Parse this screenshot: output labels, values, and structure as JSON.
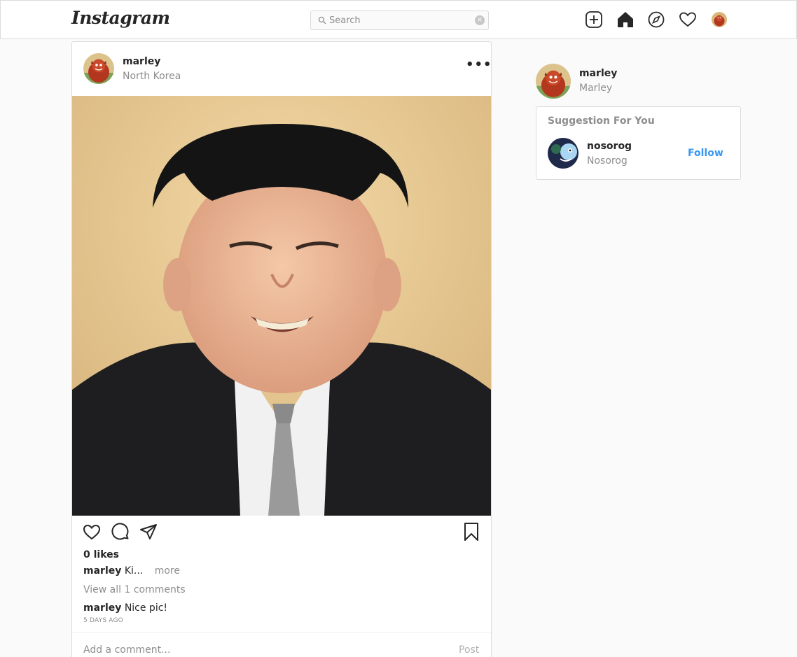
{
  "header": {
    "logo": "Instagram",
    "search_placeholder": "Search",
    "clear_symbol": "×",
    "icons": [
      "new-post-icon",
      "home-icon",
      "explore-icon",
      "activity-heart-icon",
      "profile-avatar"
    ]
  },
  "post": {
    "username": "marley",
    "location": "North Korea",
    "more_symbol": "•••",
    "likes": "0 likes",
    "caption_user": "marley",
    "caption_text": "Ki...",
    "caption_more": "more",
    "view_all": "View all 1 comments",
    "comment_user": "marley",
    "comment_text": "Nice pic!",
    "time": "5 DAYS AGO",
    "add_comment_placeholder": "Add a comment...",
    "post_label": "Post",
    "icons": [
      "like-heart-icon",
      "comment-icon",
      "share-icon",
      "bookmark-icon"
    ]
  },
  "sidebar": {
    "username": "marley",
    "fullname": "Marley",
    "suggestions_title": "Suggestion For You",
    "suggestions": [
      {
        "username": "nosorog",
        "fullname": "Nosorog",
        "follow_label": "Follow"
      }
    ]
  },
  "colors": {
    "link_blue": "#3897f0",
    "border": "#dbdbdb",
    "muted_text": "#8e8e8e",
    "background": "#fafafa"
  }
}
